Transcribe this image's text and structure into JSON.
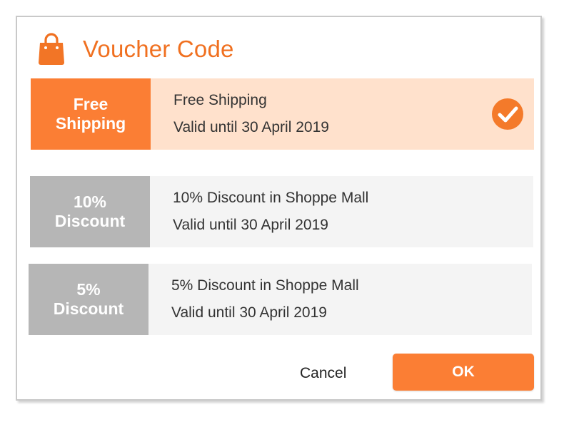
{
  "dialog": {
    "title": "Voucher Code",
    "bag_icon": "shopping-bag-icon",
    "vouchers": [
      {
        "tag_line1": "Free",
        "tag_line2": "Shipping",
        "name": "Free Shipping",
        "validity": "Valid until 30 April 2019",
        "selected": true
      },
      {
        "tag_line1": "10%",
        "tag_line2": "Discount",
        "name": "10% Discount in Shoppe Mall",
        "validity": "Valid until 30 April 2019",
        "selected": false
      },
      {
        "tag_line1": "5%",
        "tag_line2": "Discount",
        "name": "5% Discount in Shoppe Mall",
        "validity": "Valid until 30 April 2019",
        "selected": false
      }
    ],
    "cancel_label": "Cancel",
    "ok_label": "OK",
    "check_icon": "checkmark-circle-icon"
  },
  "colors": {
    "accent": "#fb7e34",
    "title": "#f07020",
    "selected_bg": "#ffe1cc",
    "tag_inactive": "#b6b6b6",
    "row_inactive": "#f4f4f4"
  }
}
